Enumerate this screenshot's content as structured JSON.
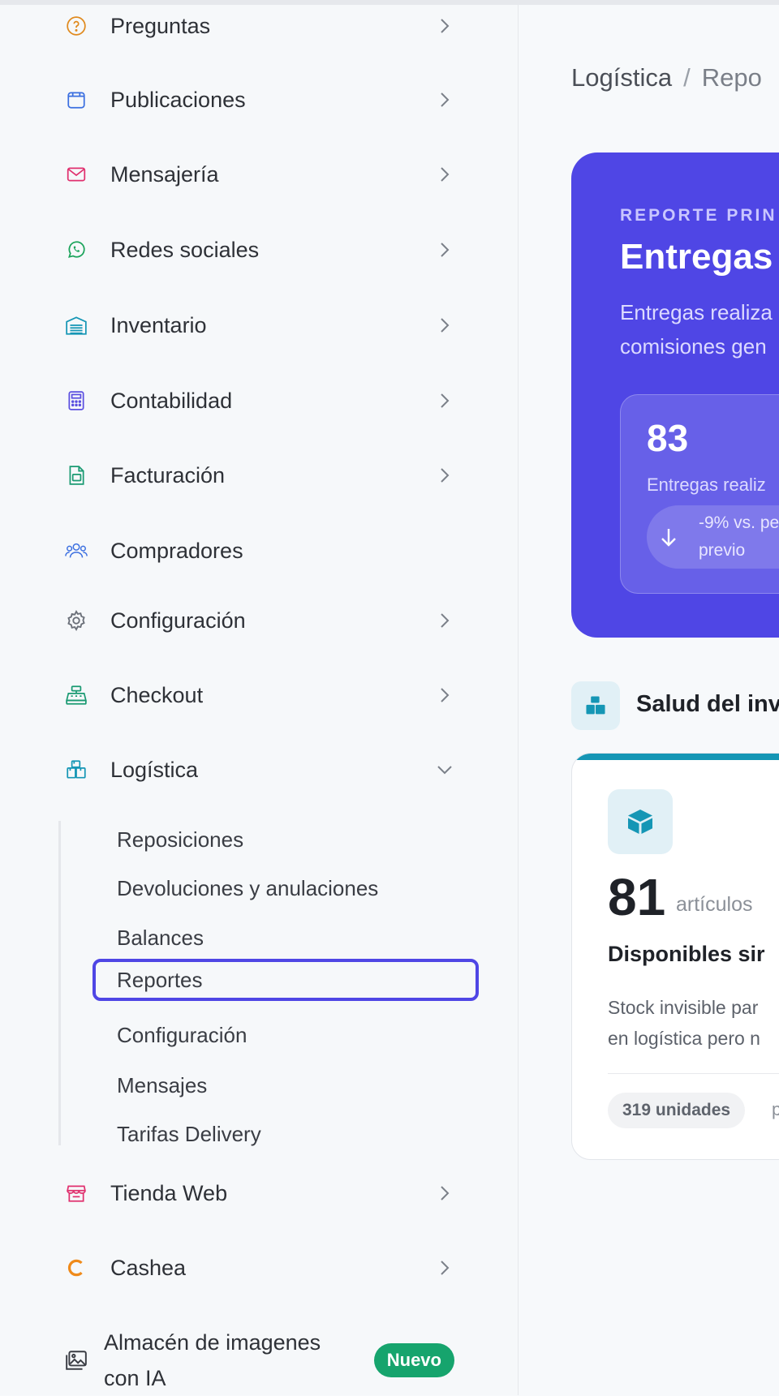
{
  "sidebar": {
    "items": [
      {
        "label": "Preguntas",
        "icon": "question-circle-icon"
      },
      {
        "label": "Publicaciones",
        "icon": "window-icon"
      },
      {
        "label": "Mensajería",
        "icon": "mail-icon"
      },
      {
        "label": "Redes sociales",
        "icon": "whatsapp-icon"
      },
      {
        "label": "Inventario",
        "icon": "warehouse-icon"
      },
      {
        "label": "Contabilidad",
        "icon": "calculator-icon"
      },
      {
        "label": "Facturación",
        "icon": "invoice-icon"
      },
      {
        "label": "Compradores",
        "icon": "users-icon"
      },
      {
        "label": "Configuración",
        "icon": "gear-icon"
      },
      {
        "label": "Checkout",
        "icon": "cash-register-icon"
      },
      {
        "label": "Logística",
        "icon": "boxes-icon"
      }
    ],
    "logistica_sub": [
      "Reposiciones",
      "Devoluciones y anulaciones",
      "Balances",
      "Reportes",
      "Configuración",
      "Mensajes",
      "Tarifas Delivery"
    ],
    "active_sub": "Reportes",
    "after_items": [
      {
        "label": "Tienda Web",
        "icon": "store-icon"
      },
      {
        "label": "Cashea",
        "icon": "cashea-icon"
      }
    ],
    "ai_item": {
      "label_line1": "Almacén de imagenes",
      "label_line2": "con IA",
      "badge": "Nuevo",
      "icon": "images-icon"
    }
  },
  "colors": {
    "accent": "#4f46e5",
    "teal": "#1596b5",
    "badge_green": "#16a46d"
  },
  "breadcrumb": {
    "parent": "Logística",
    "separator": "/",
    "current": "Repo"
  },
  "hero": {
    "eyebrow": "REPORTE PRIN",
    "title": "Entregas",
    "desc_line1": "Entregas realiza",
    "desc_line2": "comisiones gen",
    "stat": {
      "value": "83",
      "label": "Entregas realiz",
      "change_line1": "-9% vs. pe",
      "change_line2": "previo"
    }
  },
  "section": {
    "title": "Salud del inv"
  },
  "inventory_card": {
    "number": "81",
    "unit": "artículos",
    "title": "Disponibles sir",
    "desc_line1": "Stock invisible par",
    "desc_line2": "en logística pero n",
    "pill": "319 unidades",
    "trail": "p"
  }
}
